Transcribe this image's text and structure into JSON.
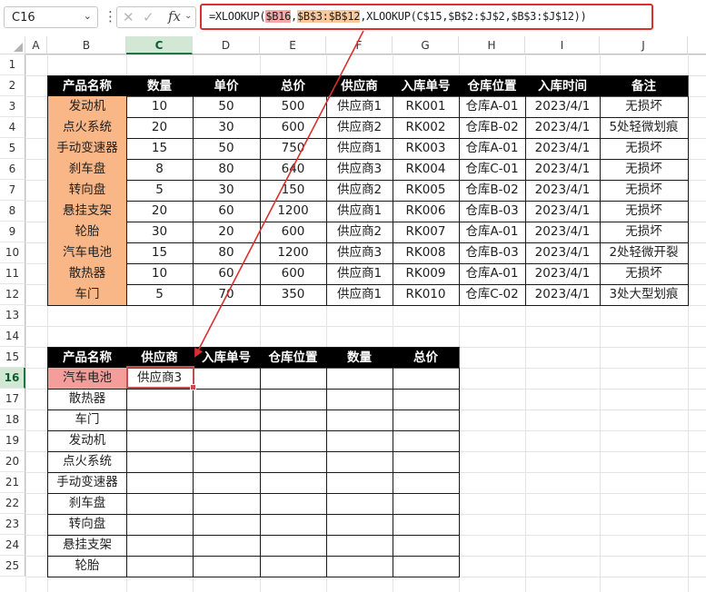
{
  "name_box": "C16",
  "formula": {
    "pre": "=XLOOKUP(",
    "arg1": "$B16",
    "sep1": ",",
    "arg2": "$B$3:$B$12",
    "rest": ",XLOOKUP(C$15,$B$2:$J$2,$B$3:$J$12))"
  },
  "columns": [
    "A",
    "B",
    "C",
    "D",
    "E",
    "F",
    "G",
    "H",
    "I",
    "J"
  ],
  "rows": [
    "1",
    "2",
    "3",
    "4",
    "5",
    "6",
    "7",
    "8",
    "9",
    "10",
    "11",
    "12",
    "13",
    "14",
    "15",
    "16",
    "17",
    "18",
    "19",
    "20",
    "21",
    "22",
    "23",
    "24",
    "25"
  ],
  "table1": {
    "headers": [
      "产品名称",
      "数量",
      "单价",
      "总价",
      "供应商",
      "入库单号",
      "仓库位置",
      "入库时间",
      "备注"
    ],
    "rows": [
      [
        "发动机",
        "10",
        "50",
        "500",
        "供应商1",
        "RK001",
        "仓库A-01",
        "2023/4/1",
        "无损坏"
      ],
      [
        "点火系统",
        "20",
        "30",
        "600",
        "供应商2",
        "RK002",
        "仓库B-02",
        "2023/4/1",
        "5处轻微划痕"
      ],
      [
        "手动变速器",
        "15",
        "50",
        "750",
        "供应商1",
        "RK003",
        "仓库A-01",
        "2023/4/1",
        "无损坏"
      ],
      [
        "刹车盘",
        "8",
        "80",
        "640",
        "供应商3",
        "RK004",
        "仓库C-01",
        "2023/4/1",
        "无损坏"
      ],
      [
        "转向盘",
        "5",
        "30",
        "150",
        "供应商2",
        "RK005",
        "仓库B-02",
        "2023/4/1",
        "无损坏"
      ],
      [
        "悬挂支架",
        "20",
        "60",
        "1200",
        "供应商1",
        "RK006",
        "仓库B-03",
        "2023/4/1",
        "无损坏"
      ],
      [
        "轮胎",
        "30",
        "20",
        "600",
        "供应商2",
        "RK007",
        "仓库A-01",
        "2023/4/1",
        "无损坏"
      ],
      [
        "汽车电池",
        "15",
        "80",
        "1200",
        "供应商3",
        "RK008",
        "仓库B-03",
        "2023/4/1",
        "2处轻微开裂"
      ],
      [
        "散热器",
        "10",
        "60",
        "600",
        "供应商1",
        "RK009",
        "仓库A-01",
        "2023/4/1",
        "无损坏"
      ],
      [
        "车门",
        "5",
        "70",
        "350",
        "供应商1",
        "RK010",
        "仓库C-02",
        "2023/4/1",
        "3处大型划痕"
      ]
    ]
  },
  "table2": {
    "headers": [
      "产品名称",
      "供应商",
      "入库单号",
      "仓库位置",
      "数量",
      "总价"
    ],
    "rows": [
      [
        "汽车电池",
        "供应商3",
        "",
        "",
        "",
        ""
      ],
      [
        "散热器",
        "",
        "",
        "",
        "",
        ""
      ],
      [
        "车门",
        "",
        "",
        "",
        "",
        ""
      ],
      [
        "发动机",
        "",
        "",
        "",
        "",
        ""
      ],
      [
        "点火系统",
        "",
        "",
        "",
        "",
        ""
      ],
      [
        "手动变速器",
        "",
        "",
        "",
        "",
        ""
      ],
      [
        "刹车盘",
        "",
        "",
        "",
        "",
        ""
      ],
      [
        "转向盘",
        "",
        "",
        "",
        "",
        ""
      ],
      [
        "悬挂支架",
        "",
        "",
        "",
        "",
        ""
      ],
      [
        "轮胎",
        "",
        "",
        "",
        "",
        ""
      ]
    ]
  },
  "colors": {
    "header_bg": "#000000",
    "name_bg": "#f9b787",
    "name_highlight": "#f49d9b",
    "annotation_red": "#d9302f"
  }
}
